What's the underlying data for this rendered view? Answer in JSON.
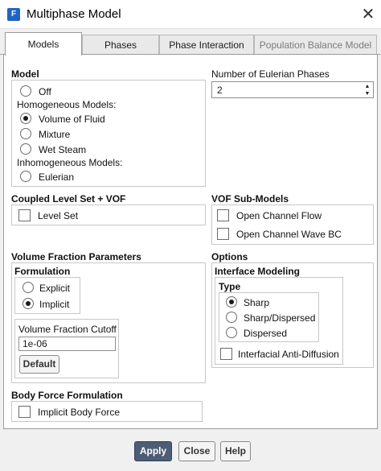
{
  "window": {
    "title": "Multiphase Model",
    "app_badge": "F"
  },
  "tabs": [
    {
      "label": "Models"
    },
    {
      "label": "Phases"
    },
    {
      "label": "Phase Interaction"
    },
    {
      "label": "Population Balance Model"
    }
  ],
  "model": {
    "title": "Model",
    "off": "Off",
    "homogeneous_title": "Homogeneous Models:",
    "vof": "Volume of Fluid",
    "mixture": "Mixture",
    "wet_steam": "Wet Steam",
    "inhomogeneous_title": "Inhomogeneous Models:",
    "eulerian": "Eulerian",
    "selected": "Volume of Fluid"
  },
  "eulerian_phases": {
    "label": "Number of Eulerian Phases",
    "value": "2"
  },
  "coupled": {
    "title": "Coupled Level Set + VOF",
    "level_set": "Level Set"
  },
  "vof_sub": {
    "title": "VOF Sub-Models",
    "open_channel_flow": "Open Channel Flow",
    "open_channel_wave": "Open Channel Wave BC"
  },
  "vfp": {
    "title": "Volume Fraction Parameters",
    "formulation_title": "Formulation",
    "explicit": "Explicit",
    "implicit": "Implicit",
    "selected": "Implicit",
    "cutoff_label": "Volume Fraction Cutoff",
    "cutoff_value": "1e-06",
    "default_button": "Default"
  },
  "options": {
    "title": "Options",
    "interface_title": "Interface Modeling",
    "type_title": "Type",
    "sharp": "Sharp",
    "sharp_dispersed": "Sharp/Dispersed",
    "dispersed": "Dispersed",
    "selected": "Sharp",
    "anti_diffusion": "Interfacial Anti-Diffusion"
  },
  "body_force": {
    "title": "Body Force Formulation",
    "implicit": "Implicit Body Force"
  },
  "footer": {
    "apply": "Apply",
    "close": "Close",
    "help": "Help"
  }
}
